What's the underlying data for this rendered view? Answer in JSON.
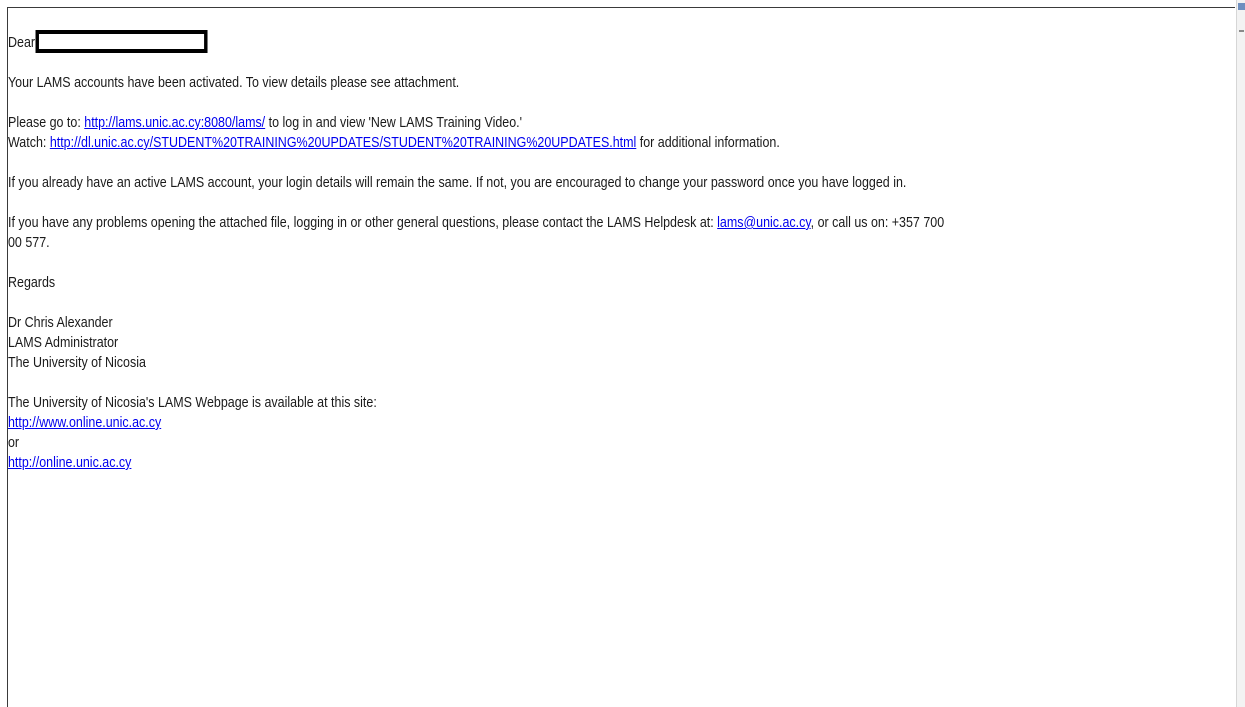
{
  "email": {
    "salutation": "Dear",
    "p1": "Your LAMS accounts have been activated. To view details please see attachment.",
    "p2_before": "Please go to: ",
    "p2_link": "http://lams.unic.ac.cy:8080/lams/",
    "p2_after": " to log in and view 'New LAMS Training Video.'",
    "p3_before": "Watch: ",
    "p3_link": "http://dl.unic.ac.cy/STUDENT%20TRAINING%20UPDATES/STUDENT%20TRAINING%20UPDATES.html",
    "p3_after": " for additional information.",
    "p4": "If you already have an active LAMS account, your login details will remain the same. If not, you are encouraged to change your password once you have logged in.",
    "p5_before": "If you have any problems opening the attached file, logging in or other general questions, please contact the LAMS Helpdesk at: ",
    "p5_link": "lams@unic.ac.cy",
    "p5_after_line1": ", or call us on: +357 700",
    "p5_after_line2": "00 577.",
    "regards": "Regards",
    "sig_name": "Dr Chris Alexander",
    "sig_title": "LAMS Administrator",
    "sig_org": "The University of Nicosia",
    "site_intro": "The University of Nicosia's LAMS Webpage is available at this site:",
    "site_link1": "http://www.online.unic.ac.cy",
    "site_or": "or",
    "site_link2": "http://online.unic.ac.cy"
  }
}
